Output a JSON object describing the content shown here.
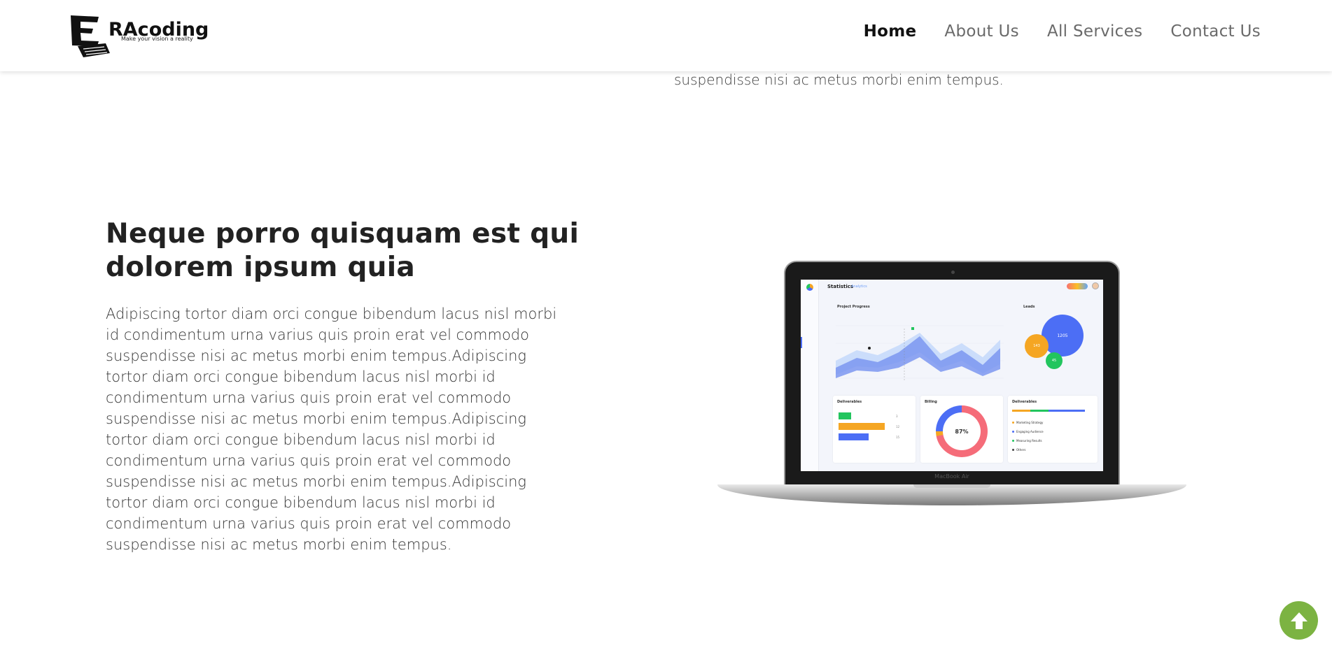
{
  "header": {
    "logo": {
      "brand_main": "RAcoding",
      "brand_letter": "E",
      "tagline": "Make your vision a reality"
    },
    "nav": [
      {
        "label": "Home",
        "active": true
      },
      {
        "label": "About Us",
        "active": false
      },
      {
        "label": "All Services",
        "active": false
      },
      {
        "label": "Contact Us",
        "active": false
      }
    ]
  },
  "previous_section": {
    "tail_text": "suspendisse nisi ac metus morbi enim tempus."
  },
  "section": {
    "heading": "Neque porro quisquam est qui dolorem ipsum quia",
    "paragraph": "Adipiscing tortor diam orci congue bibendum lacus nisl morbi id condimentum urna varius quis proin erat vel commodo suspendisse nisi ac metus morbi enim tempus.Adipiscing tortor diam orci congue bibendum lacus nisl morbi id condimentum urna varius quis proin erat vel commodo suspendisse nisi ac metus morbi enim tempus.Adipiscing tortor diam orci congue bibendum lacus nisl morbi id condimentum urna varius quis proin erat vel commodo suspendisse nisi ac metus morbi enim tempus.Adipiscing tortor diam orci congue bibendum lacus nisl morbi id condimentum urna varius quis proin erat vel commodo suspendisse nisi ac metus morbi enim tempus."
  },
  "laptop": {
    "model_label": "MacBook Air",
    "dashboard": {
      "title": "Statistics",
      "subtitle": "Analytics",
      "panel_progress": "Project Progress",
      "panel_leads": "Leads",
      "panel_deliverables": "Deliverables",
      "panel_billing": "Billing",
      "panel_deliverables_2": "Deliverables",
      "billing_percent": "87%",
      "bubble_values": [
        "1205",
        "143",
        "45"
      ],
      "legend_items": [
        "Marketing Strategy",
        "Engaging Audience",
        "Measuring Results",
        "Others"
      ],
      "bar_values": [
        "3",
        "12",
        "15"
      ]
    }
  },
  "scroll_top": {
    "icon": "arrow-up-icon",
    "color": "#7cb342"
  },
  "colors": {
    "nav_active": "#111111",
    "nav_inactive": "#6a6a6a",
    "accent_green": "#7cb342"
  }
}
